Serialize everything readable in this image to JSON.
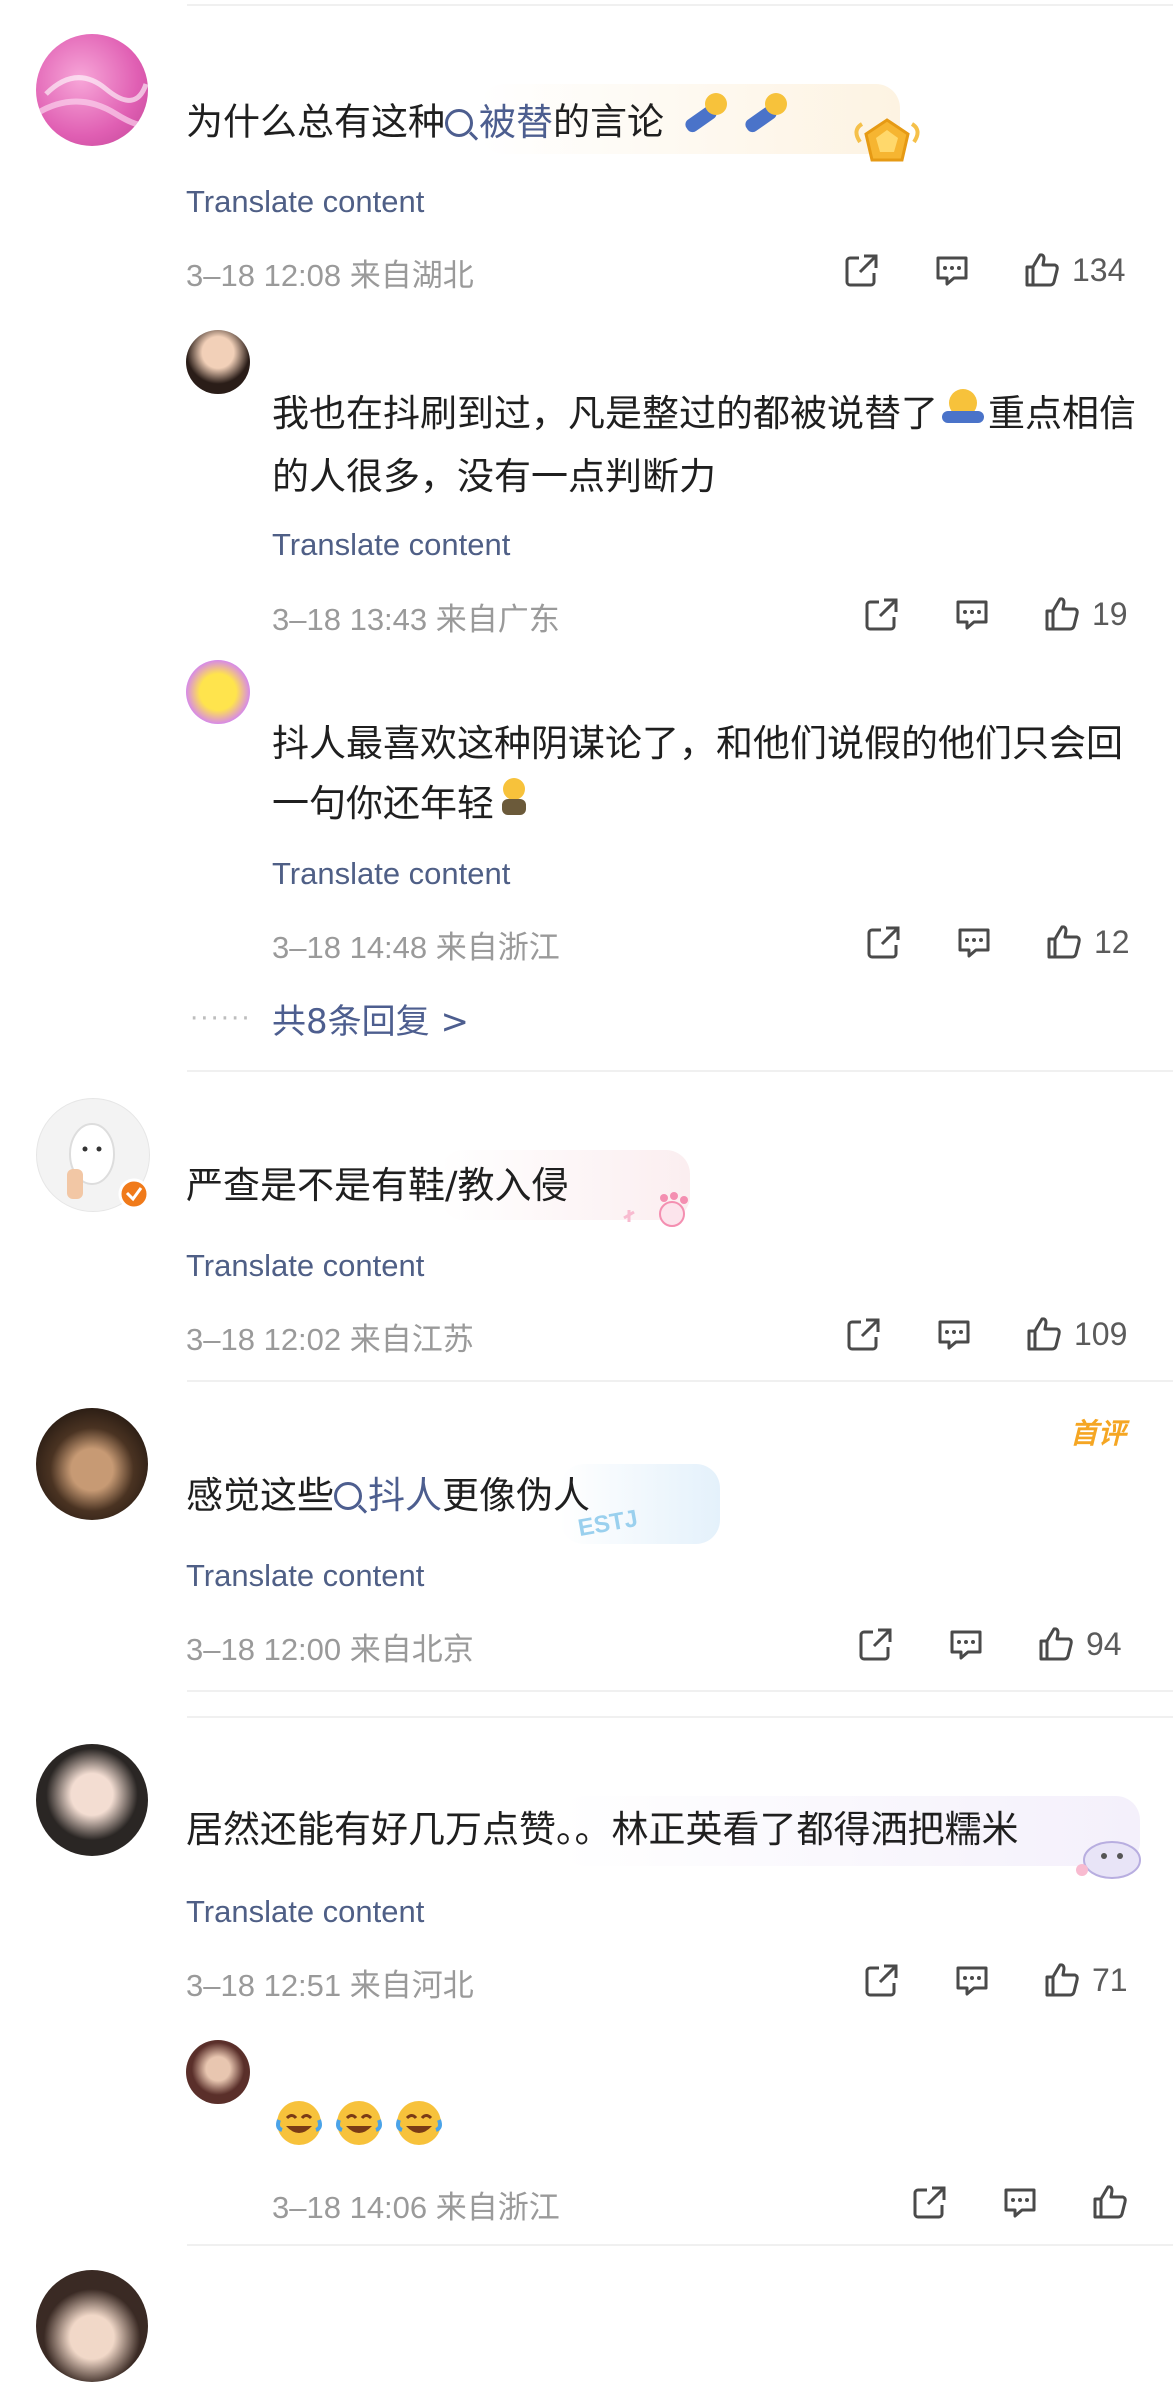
{
  "common": {
    "translate_label": "Translate content"
  },
  "comments": [
    {
      "text_pre": "为什么总有这种",
      "text_link": "被替",
      "text_post": "的言论",
      "meta": "3–18 12:08  来自湖北",
      "likes": "134"
    },
    {
      "text": "我也在抖刷到过，凡是整过的都被说替了",
      "text_tail": "重点相信的人很多，没有一点判断力",
      "meta": "3–18 13:43  来自广东",
      "likes": "19"
    },
    {
      "text": "抖人最喜欢这种阴谋论了，和他们说假的他们只会回一句你还年轻",
      "meta": "3–18 14:48  来自浙江",
      "likes": "12"
    },
    {
      "more_replies": "共8条回复 >",
      "dots": "······"
    },
    {
      "text": "严查是不是有鞋/教入侵",
      "meta": "3–18 12:02  来自江苏",
      "likes": "109"
    },
    {
      "text_pre": "感觉这些",
      "text_link": "抖人",
      "text_post": "更像伪人",
      "tag": "首评",
      "badge_text": "ESTJ",
      "meta": "3–18 12:00  来自北京",
      "likes": "94"
    },
    {
      "text": "居然还能有好几万点赞。。林正英看了都得洒把糯米",
      "meta": "3–18 12:51  来自河北",
      "likes": "71"
    },
    {
      "meta": "3–18 14:06  来自浙江"
    }
  ],
  "colors": {
    "link": "#4d5e8f",
    "meta": "#9a9a9a",
    "accent_orange": "#f5a623"
  }
}
